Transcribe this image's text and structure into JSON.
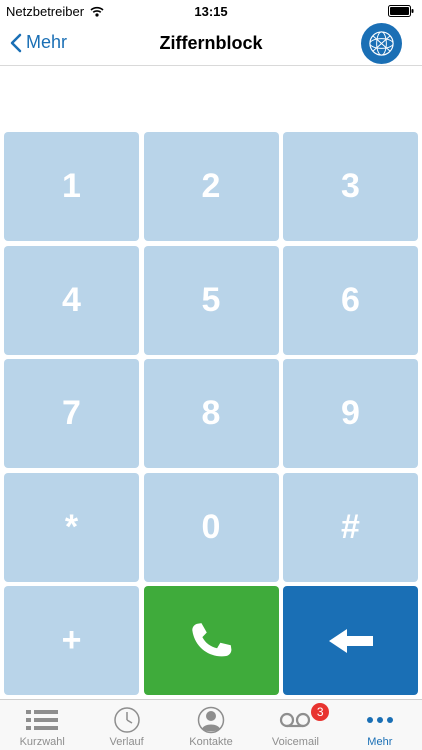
{
  "status_bar": {
    "carrier": "Netzbetreiber",
    "time": "13:15"
  },
  "nav": {
    "back_label": "Mehr",
    "title": "Ziffernblock"
  },
  "display": {
    "number": ""
  },
  "keypad": {
    "keys": [
      "1",
      "2",
      "3",
      "4",
      "5",
      "6",
      "7",
      "8",
      "9",
      "*",
      "0",
      "#",
      "+"
    ]
  },
  "tabs": [
    {
      "label": "Kurzwahl",
      "icon": "list-icon",
      "active": false
    },
    {
      "label": "Verlauf",
      "icon": "clock-icon",
      "active": false
    },
    {
      "label": "Kontakte",
      "icon": "contact-icon",
      "active": false
    },
    {
      "label": "Voicemail",
      "icon": "voicemail-icon",
      "active": false,
      "badge": "3"
    },
    {
      "label": "Mehr",
      "icon": "more-icon",
      "active": true
    }
  ],
  "colors": {
    "accent": "#1a6fb5",
    "key": "#b9d4e9",
    "call": "#3fab3b",
    "badge": "#e8332f"
  }
}
